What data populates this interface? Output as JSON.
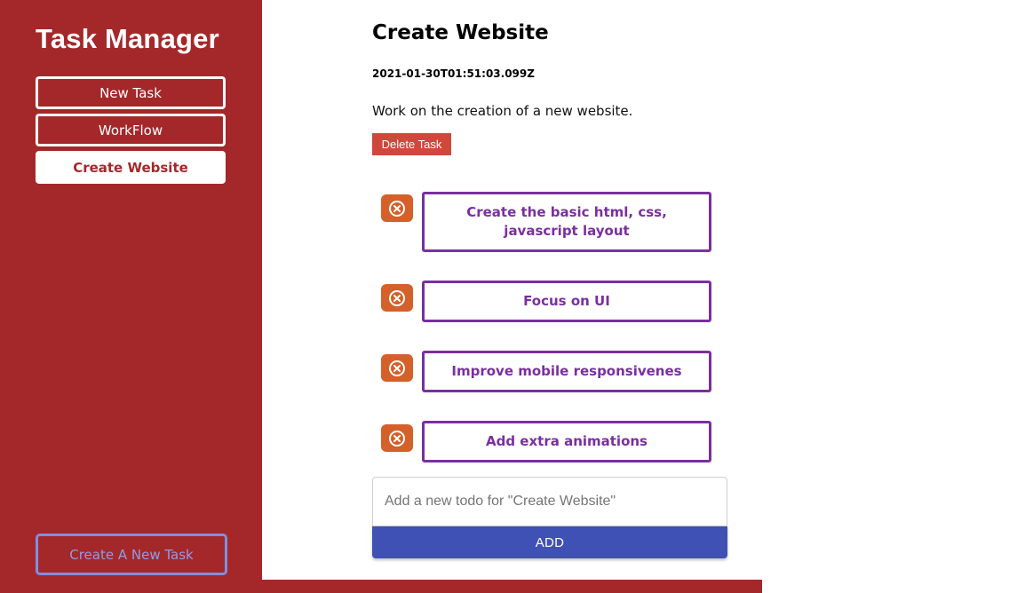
{
  "app": {
    "title": "Task Manager"
  },
  "sidebar": {
    "tasks": [
      {
        "label": "New Task",
        "active": false
      },
      {
        "label": "WorkFlow",
        "active": false
      },
      {
        "label": "Create Website",
        "active": true
      }
    ],
    "create_button_label": "Create A New Task"
  },
  "task": {
    "title": "Create Website",
    "date": "2021-01-30T01:51:03.099Z",
    "description": "Work on the creation of a new website.",
    "delete_label": "Delete Task",
    "todos": [
      {
        "text": "Create the basic html, css, javascript layout"
      },
      {
        "text": "Focus on UI"
      },
      {
        "text": "Improve mobile responsivenes"
      },
      {
        "text": "Add extra animations"
      }
    ]
  },
  "new_todo": {
    "placeholder": "Add a new todo for \"Create Website\"",
    "value": "",
    "add_label": "ADD"
  },
  "colors": {
    "sidebar_bg": "#a4282a",
    "todo_border": "#7b2fa0",
    "remove_button": "#d4602a",
    "delete_button": "#d0473b",
    "add_button": "#3f51b5",
    "create_task_border": "#7f8fe0"
  },
  "icons": {
    "todo_remove": "close-circle-icon"
  }
}
